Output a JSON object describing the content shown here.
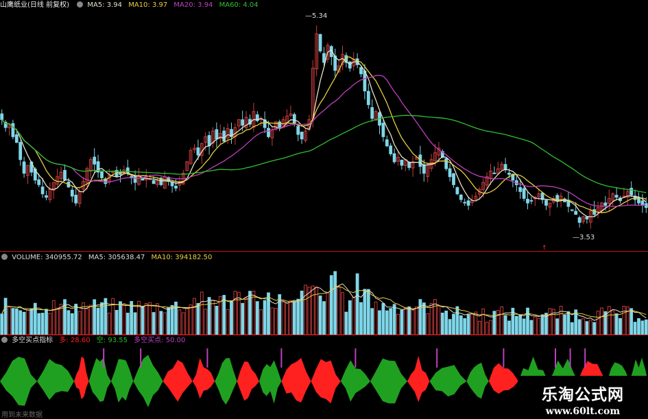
{
  "price_panel": {
    "stock_name": "山鹰纸业(日线 前复权)",
    "ma5": {
      "label": "MA5:",
      "value": "3.94",
      "color": "#e8e0c8"
    },
    "ma10": {
      "label": "MA10:",
      "value": "3.97",
      "color": "#e8d040"
    },
    "ma20": {
      "label": "MA20:",
      "value": "3.94",
      "color": "#c040c0"
    },
    "ma60": {
      "label": "MA60:",
      "value": "4.04",
      "color": "#30c030"
    },
    "high_marker": "5.34",
    "low_marker": "3.53"
  },
  "volume_panel": {
    "title": "VOLUME:",
    "value": "340955.72",
    "ma5": {
      "label": "MA5:",
      "value": "305638.47"
    },
    "ma10": {
      "label": "MA10:",
      "value": "394182.50"
    }
  },
  "indicator_panel": {
    "title": "多空买点指标",
    "long": {
      "label": "多:",
      "value": "28.60",
      "color": "#ff2020"
    },
    "short": {
      "label": "空:",
      "value": "93.55",
      "color": "#20c020"
    },
    "buy": {
      "label": "多空买点:",
      "value": "50.00",
      "color": "#c040c0"
    }
  },
  "watermark": {
    "title": "乐淘公式网",
    "url": "www.60lt.com"
  },
  "footer": "用到未来数据",
  "colors": {
    "up": "#c83c3c",
    "down": "#7fd6e8",
    "divider": "#c8141e",
    "ma60": "#30c030"
  },
  "chart_data": {
    "type": "candlestick",
    "price_range": [
      3.3,
      5.4
    ],
    "closes": [
      4.45,
      4.38,
      4.41,
      4.3,
      4.25,
      4.1,
      3.98,
      4.05,
      3.99,
      3.92,
      3.88,
      3.8,
      3.77,
      3.84,
      3.9,
      3.95,
      3.99,
      3.92,
      3.86,
      3.78,
      3.72,
      3.82,
      3.91,
      4.02,
      4.1,
      4.06,
      3.99,
      3.94,
      3.89,
      3.96,
      4.0,
      3.95,
      3.97,
      4.01,
      3.98,
      3.94,
      3.9,
      3.96,
      3.92,
      3.95,
      3.93,
      3.89,
      3.92,
      3.88,
      3.95,
      3.91,
      3.87,
      3.85,
      3.9,
      3.98,
      4.08,
      4.18,
      4.2,
      4.14,
      4.24,
      4.3,
      4.22,
      4.35,
      4.28,
      4.33,
      4.26,
      4.37,
      4.3,
      4.38,
      4.45,
      4.4,
      4.47,
      4.41,
      4.52,
      4.44,
      4.46,
      4.38,
      4.3,
      4.36,
      4.43,
      4.38,
      4.45,
      4.48,
      4.5,
      4.42,
      4.32,
      4.28,
      4.35,
      4.45,
      4.9,
      5.2,
      5.05,
      4.95,
      5.1,
      5.0,
      4.88,
      4.92,
      5.02,
      4.95,
      4.9,
      4.98,
      4.93,
      4.85,
      4.7,
      4.58,
      4.46,
      4.52,
      4.4,
      4.3,
      4.22,
      4.15,
      4.08,
      4.12,
      4.05,
      4.1,
      4.03,
      4.08,
      4.12,
      4.04,
      3.98,
      4.05,
      4.1,
      4.16,
      4.2,
      4.12,
      4.02,
      3.95,
      3.88,
      3.8,
      3.75,
      3.72,
      3.7,
      3.74,
      3.78,
      3.84,
      3.9,
      3.95,
      4.0,
      3.98,
      4.02,
      4.06,
      4.01,
      3.97,
      3.92,
      3.88,
      3.82,
      3.76,
      3.72,
      3.74,
      3.77,
      3.8,
      3.75,
      3.7,
      3.72,
      3.76,
      3.74,
      3.78,
      3.73,
      3.69,
      3.66,
      3.62,
      3.55,
      3.6,
      3.58,
      3.65,
      3.62,
      3.68,
      3.72,
      3.7,
      3.76,
      3.8,
      3.77,
      3.74,
      3.78,
      3.82,
      3.79,
      3.75,
      3.72,
      3.7,
      3.68
    ],
    "ma_series": [
      "MA5",
      "MA10",
      "MA20",
      "MA60"
    ]
  }
}
